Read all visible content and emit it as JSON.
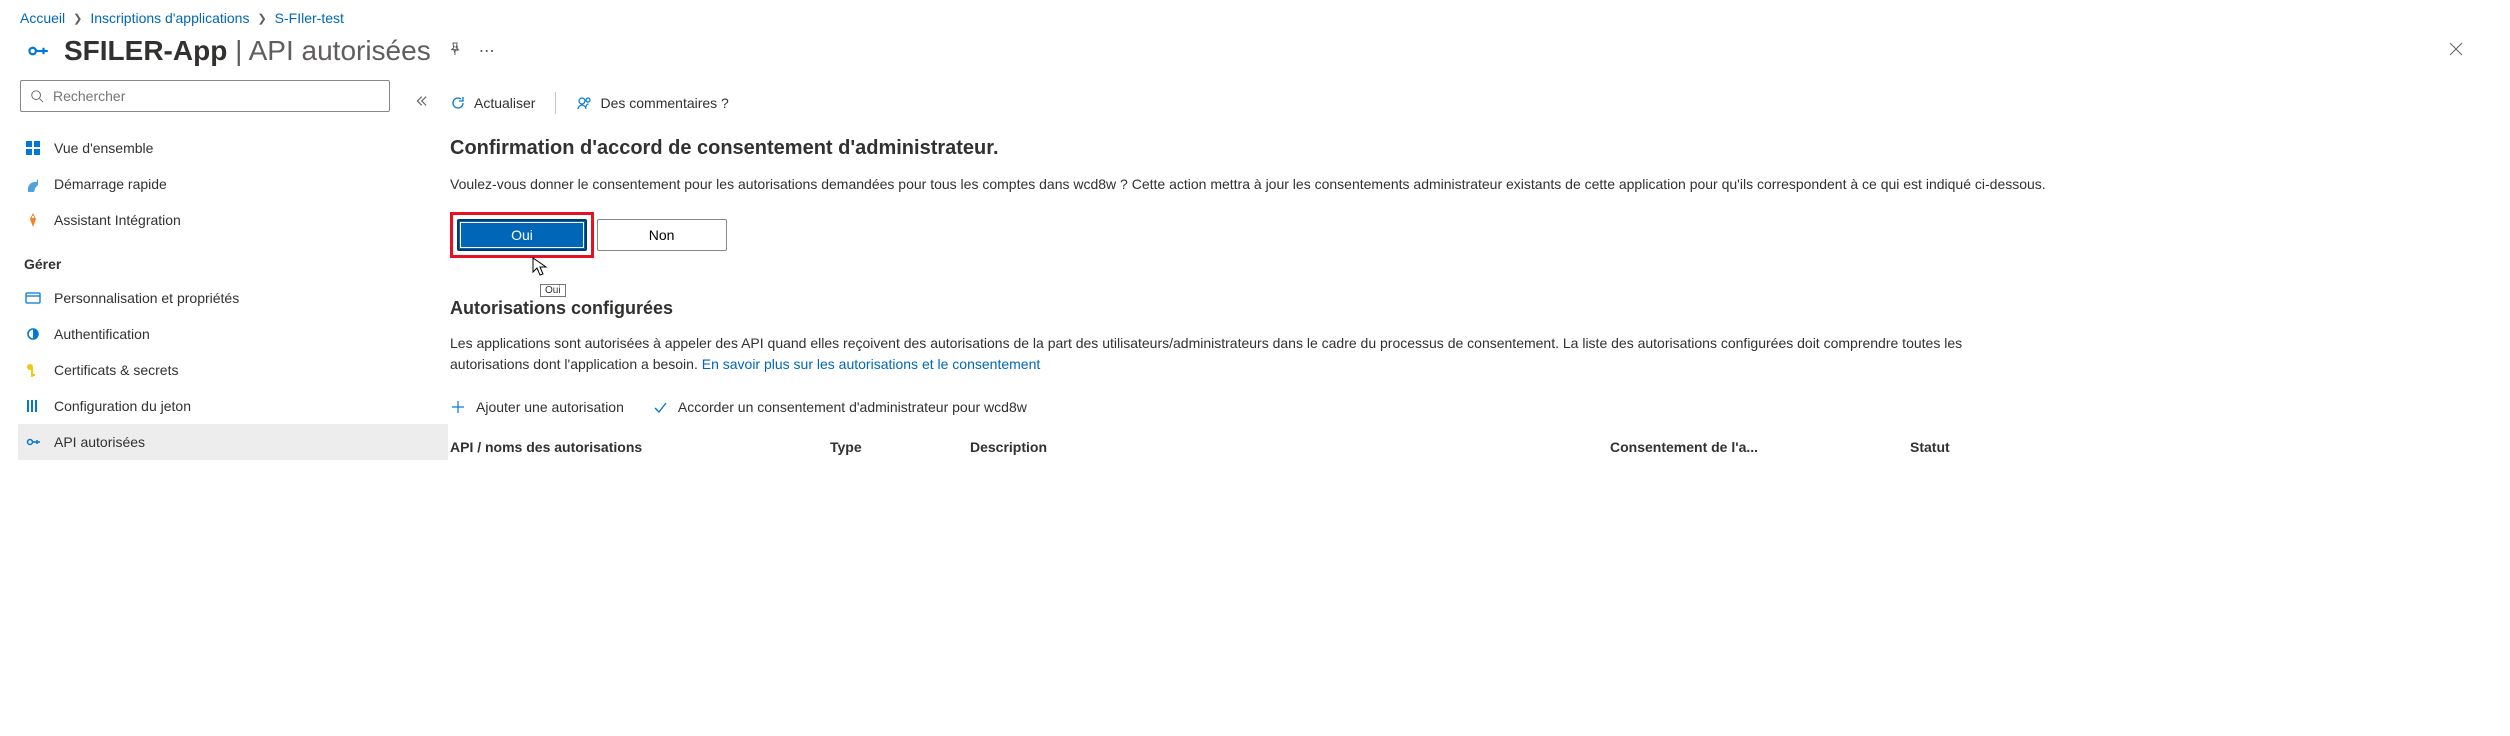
{
  "breadcrumb": {
    "items": [
      "Accueil",
      "Inscriptions d'applications",
      "S-FIler-test"
    ]
  },
  "header": {
    "app_name": "SFILER-App",
    "suffix": "API autorisées"
  },
  "search": {
    "placeholder": "Rechercher"
  },
  "sidebar": {
    "overview": "Vue d'ensemble",
    "quickstart": "Démarrage rapide",
    "integration": "Assistant Intégration",
    "group_manage": "Gérer",
    "branding": "Personnalisation et propriétés",
    "auth": "Authentification",
    "certs": "Certificats & secrets",
    "token": "Configuration du jeton",
    "api_perm": "API autorisées"
  },
  "toolbar": {
    "refresh": "Actualiser",
    "feedback": "Des commentaires ?"
  },
  "prompt": {
    "title": "Confirmation d'accord de consentement d'administrateur.",
    "body": "Voulez-vous donner le consentement pour les autorisations demandées pour tous les comptes dans wcd8w ? Cette action mettra à jour les consentements administrateur existants de cette application pour qu'ils correspondent à ce qui est indiqué ci-dessous.",
    "yes": "Oui",
    "no": "Non",
    "tooltip": "Oui"
  },
  "configured": {
    "title": "Autorisations configurées",
    "body_pre": "Les applications sont autorisées à appeler des API quand elles reçoivent des autorisations de la part des utilisateurs/administrateurs dans le cadre du processus de consentement. La liste des autorisations configurées doit comprendre toutes les autorisations dont l'application a besoin. ",
    "link": "En savoir plus sur les autorisations et le consentement",
    "add": "Ajouter une autorisation",
    "grant": "Accorder un consentement d'administrateur pour wcd8w"
  },
  "table": {
    "col1": "API / noms des autorisations",
    "col2": "Type",
    "col3": "Description",
    "col4": "Consentement de l'a...",
    "col5": "Statut"
  }
}
